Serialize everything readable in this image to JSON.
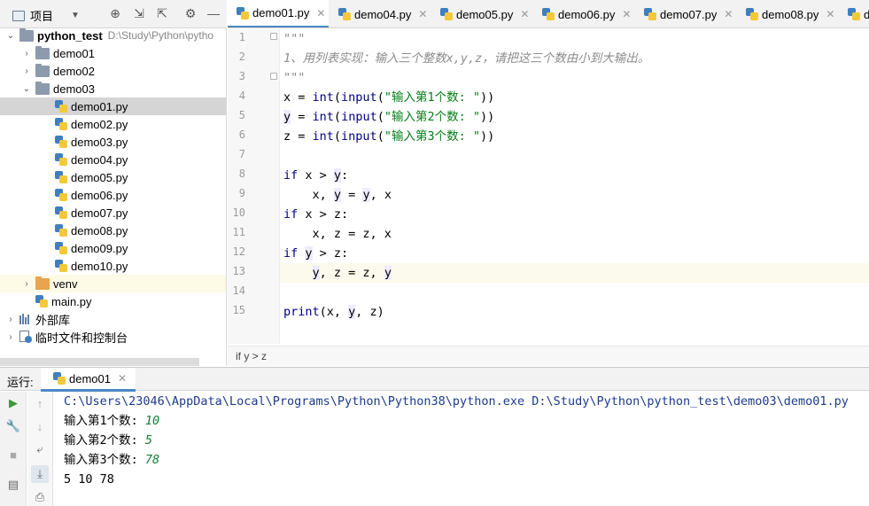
{
  "project_panel": {
    "title": "项目",
    "root": {
      "name": "python_test",
      "path": "D:\\Study\\Python\\pytho"
    },
    "folders": [
      "demo01",
      "demo02",
      "demo03"
    ],
    "files": [
      "demo01.py",
      "demo02.py",
      "demo03.py",
      "demo04.py",
      "demo05.py",
      "demo06.py",
      "demo07.py",
      "demo08.py",
      "demo09.py",
      "demo10.py"
    ],
    "venv": "venv",
    "main_file": "main.py",
    "external_libs": "外部库",
    "scratches": "临时文件和控制台"
  },
  "tabs": [
    "demo01.py",
    "demo04.py",
    "demo05.py",
    "demo06.py",
    "demo07.py",
    "demo08.py",
    "d"
  ],
  "editor": {
    "line_numbers": [
      "1",
      "2",
      "3",
      "4",
      "5",
      "6",
      "7",
      "8",
      "9",
      "10",
      "11",
      "12",
      "13",
      "14",
      "15"
    ],
    "comment_line1": "\"\"\"",
    "comment_line2": "1、用列表实现：输入三个整数x,y,z，请把这三个数由小到大输出。",
    "comment_line3": "\"\"\"",
    "prompt1": "\"输入第1个数: \"",
    "prompt2": "\"输入第2个数: \"",
    "prompt3": "\"输入第3个数: \""
  },
  "breadcrumb": "if y > z",
  "run_panel": {
    "label": "运行:",
    "tab": "demo01",
    "command": "C:\\Users\\23046\\AppData\\Local\\Programs\\Python\\Python38\\python.exe D:\\Study\\Python\\python_test\\demo03\\demo01.py",
    "prompt1": "输入第1个数: ",
    "value1": "10",
    "prompt2": "输入第2个数: ",
    "value2": "5",
    "prompt3": "输入第3个数: ",
    "value3": "78",
    "result": "5 10 78"
  },
  "colors": {
    "accent": "#4a88c7",
    "selection": "#d5d5d5",
    "current_line": "#fcfaed",
    "string": "#067d17",
    "builtin": "#000080",
    "comment": "#8c8c8c"
  }
}
